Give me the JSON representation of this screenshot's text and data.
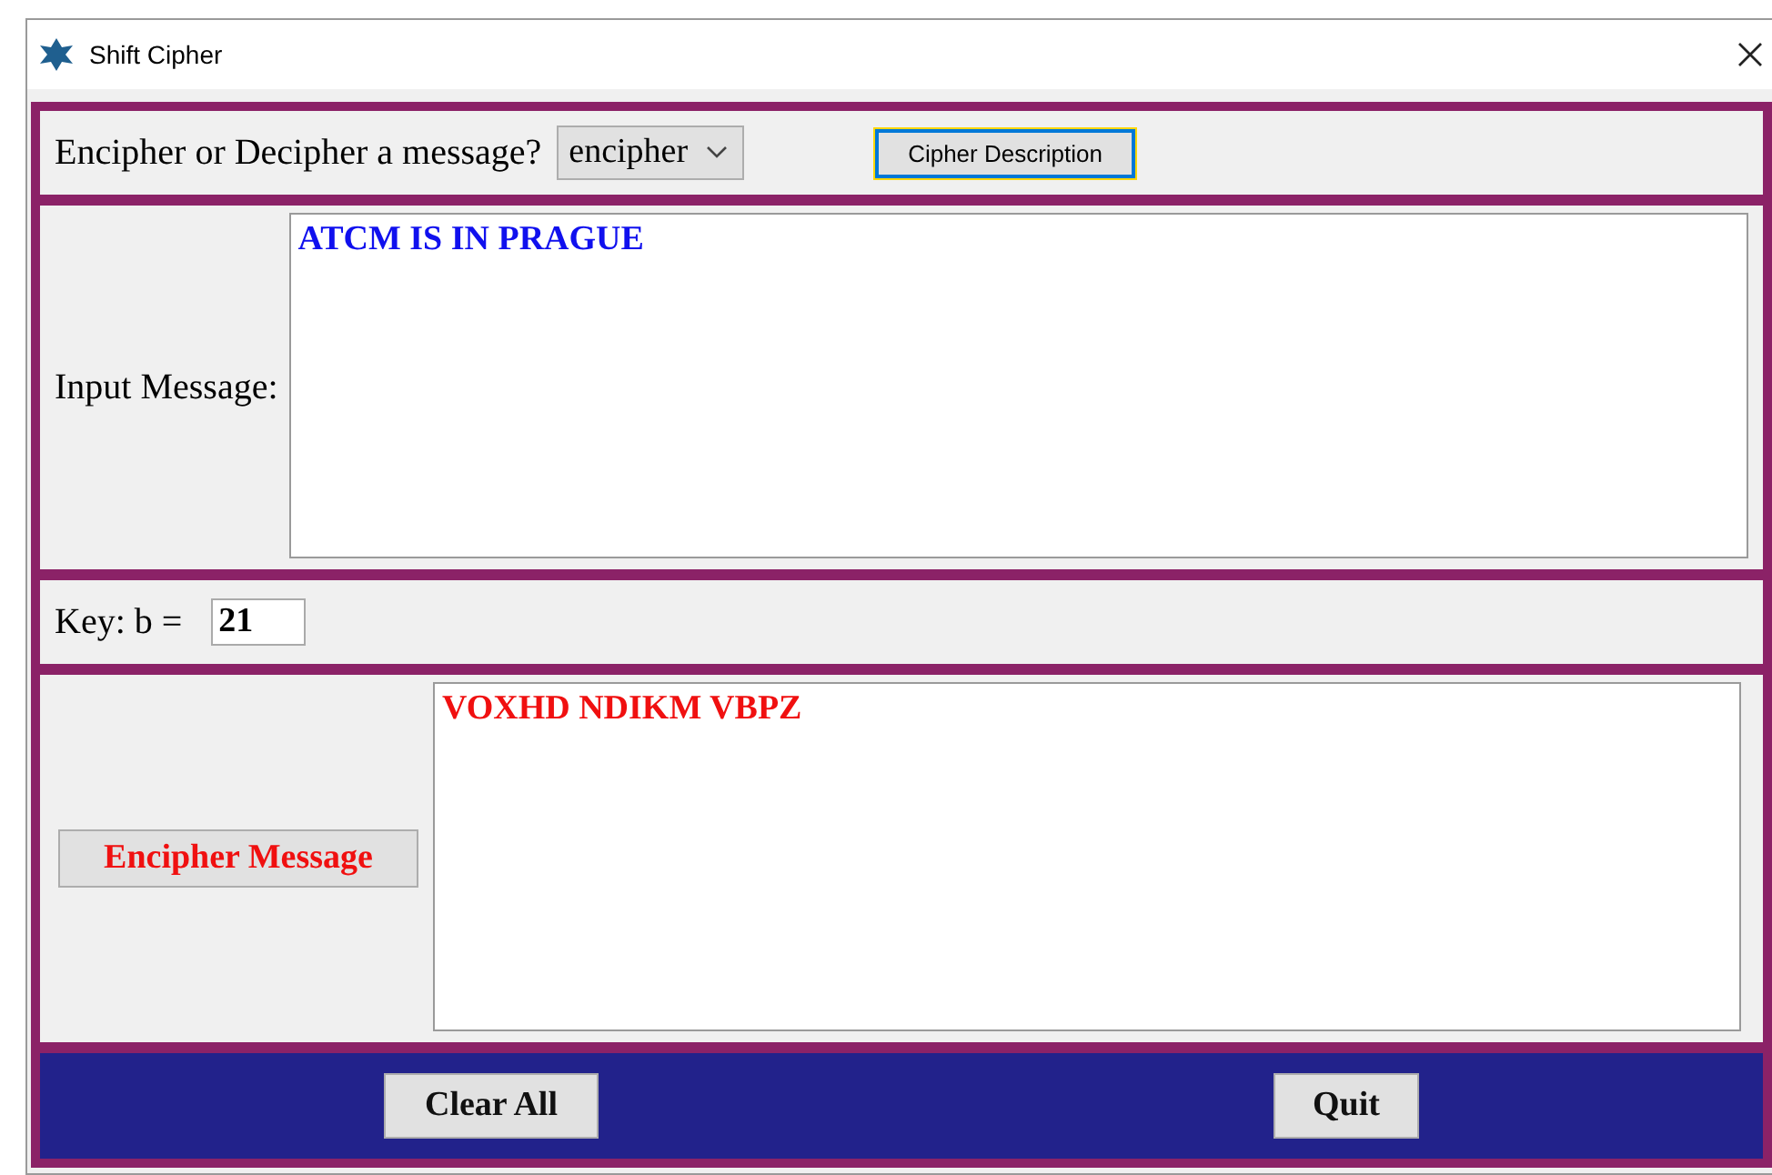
{
  "window": {
    "title": "Shift Cipher"
  },
  "mode": {
    "label": "Encipher or Decipher a message?",
    "value": "encipher"
  },
  "description_button": {
    "label": "Cipher Description",
    "focused": true
  },
  "input": {
    "label": "Input Message:",
    "value": "ATCM IS IN PRAGUE"
  },
  "key": {
    "label": "Key: b =",
    "value": "21"
  },
  "action_button": {
    "label": "Encipher Message"
  },
  "output": {
    "value": "VOXHD NDIKM VBPZ"
  },
  "buttons": [
    {
      "label": "Clear All"
    },
    {
      "label": "Quit"
    }
  ]
}
